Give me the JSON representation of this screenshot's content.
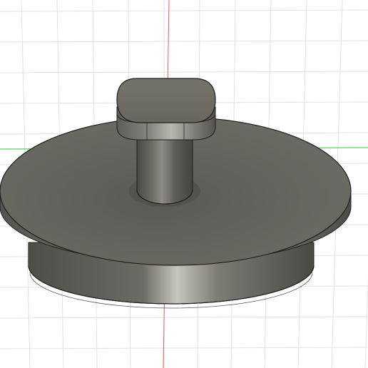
{
  "viewport": {
    "background_color": "#ffffff",
    "grid_color": "#e3e3e3",
    "axis_x_color": "#3fbf3f",
    "axis_y_color": "#e25c5c"
  },
  "model": {
    "body_color": "#6a6862",
    "edge_color": "#1f1f1f",
    "highlight_color": "#a9a7a0",
    "shadow_color": "#3f3e3a"
  }
}
